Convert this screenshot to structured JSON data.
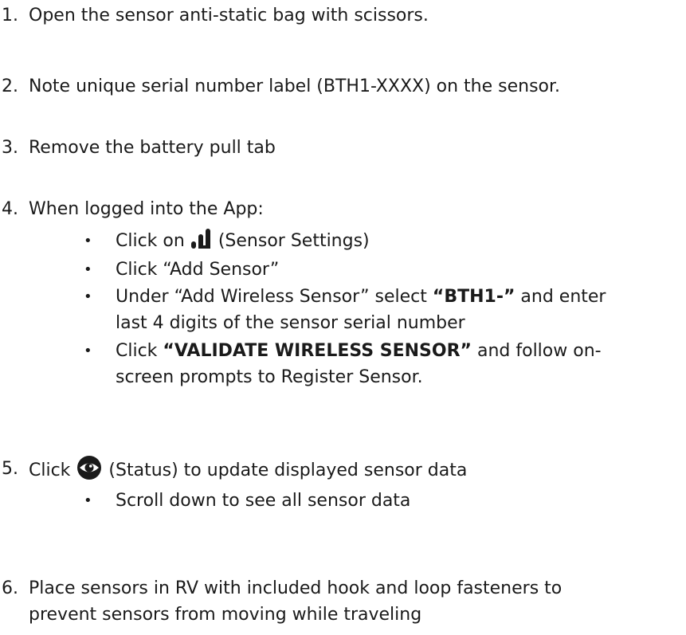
{
  "steps": [
    {
      "num": "1.",
      "text": "Open the sensor anti-static bag with scissors."
    },
    {
      "num": "2.",
      "text": "Note unique serial number label (BTH1-XXXX) on the sensor."
    },
    {
      "num": "3.",
      "text": "Remove the battery pull tab"
    },
    {
      "num": "4.",
      "text": "When logged into the App:"
    },
    {
      "num": "5.",
      "text_before": "Click",
      "text_after": "(Status) to update displayed sensor data"
    },
    {
      "num": "6.",
      "line1": "Place sensors in RV with included hook and loop fasteners to",
      "line2": "prevent sensors from moving while traveling"
    }
  ],
  "step4_bullets": {
    "b1_before": "Click on",
    "b1_after": "(Sensor Settings)",
    "b2_plain": "Click ",
    "b2_quoted": "“Add Sensor”",
    "b3_plain1": "Under “Add Wireless Sensor” select ",
    "b3_bold": "“BTH1-”",
    "b3_plain2": " and enter",
    "b3_line2": "last 4 digits of the sensor serial number",
    "b4_plain1": "Click ",
    "b4_bold": "“VALIDATE WIRELESS SENSOR”",
    "b4_plain2": " and follow on-",
    "b4_line2": "screen prompts to Register Sensor."
  },
  "step5_bullet": "Scroll down to see all sensor data",
  "icons": {
    "settings": "bar-chart-icon",
    "status": "eye-icon"
  }
}
